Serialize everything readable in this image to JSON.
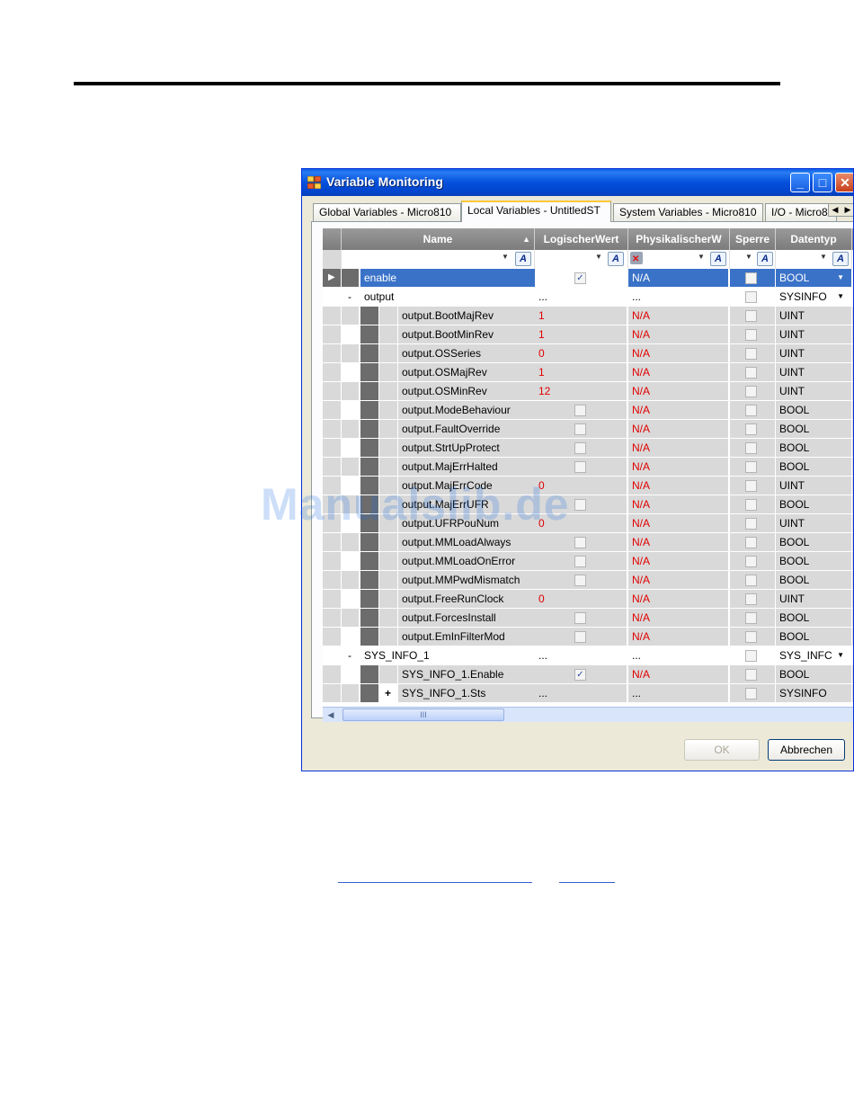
{
  "window": {
    "title": "Variable Monitoring",
    "controls": {
      "minimize": "_",
      "maximize": "□",
      "close": "✕"
    }
  },
  "tabs": [
    {
      "label": "Global Variables - Micro810",
      "active": false
    },
    {
      "label": "Local Variables - UntitledST",
      "active": true
    },
    {
      "label": "System Variables - Micro810",
      "active": false
    },
    {
      "label": "I/O - Micro810",
      "active": false
    }
  ],
  "columns": {
    "name": "Name",
    "logical": "LogischerWert",
    "physical": "PhysikalischerW",
    "lock": "Sperre",
    "type": "Datentyp"
  },
  "rows": [
    {
      "name": "enable",
      "level": 0,
      "logical": "",
      "logical_check": "✓",
      "physical": "N/A",
      "type": "BOOL",
      "selected": true,
      "expander": "",
      "dropdown": true
    },
    {
      "name": "output",
      "level": 0,
      "logical": "...",
      "physical": "...",
      "type": "SYSINFO",
      "expander": "-",
      "dropdown": true
    },
    {
      "name": "output.BootMajRev",
      "level": 1,
      "logical": "1",
      "physical": "N/A",
      "type": "UINT"
    },
    {
      "name": "output.BootMinRev",
      "level": 1,
      "logical": "1",
      "physical": "N/A",
      "type": "UINT"
    },
    {
      "name": "output.OSSeries",
      "level": 1,
      "logical": "0",
      "physical": "N/A",
      "type": "UINT"
    },
    {
      "name": "output.OSMajRev",
      "level": 1,
      "logical": "1",
      "physical": "N/A",
      "type": "UINT"
    },
    {
      "name": "output.OSMinRev",
      "level": 1,
      "logical": "12",
      "physical": "N/A",
      "type": "UINT"
    },
    {
      "name": "output.ModeBehaviour",
      "level": 1,
      "logical": "",
      "logical_check": "",
      "physical": "N/A",
      "type": "BOOL"
    },
    {
      "name": "output.FaultOverride",
      "level": 1,
      "logical": "",
      "logical_check": "",
      "physical": "N/A",
      "type": "BOOL"
    },
    {
      "name": "output.StrtUpProtect",
      "level": 1,
      "logical": "",
      "logical_check": "",
      "physical": "N/A",
      "type": "BOOL"
    },
    {
      "name": "output.MajErrHalted",
      "level": 1,
      "logical": "",
      "logical_check": "",
      "physical": "N/A",
      "type": "BOOL"
    },
    {
      "name": "output.MajErrCode",
      "level": 1,
      "logical": "0",
      "physical": "N/A",
      "type": "UINT"
    },
    {
      "name": "output.MajErrUFR",
      "level": 1,
      "logical": "",
      "logical_check": "",
      "physical": "N/A",
      "type": "BOOL"
    },
    {
      "name": "output.UFRPouNum",
      "level": 1,
      "logical": "0",
      "physical": "N/A",
      "type": "UINT"
    },
    {
      "name": "output.MMLoadAlways",
      "level": 1,
      "logical": "",
      "logical_check": "",
      "physical": "N/A",
      "type": "BOOL"
    },
    {
      "name": "output.MMLoadOnError",
      "level": 1,
      "logical": "",
      "logical_check": "",
      "physical": "N/A",
      "type": "BOOL"
    },
    {
      "name": "output.MMPwdMismatch",
      "level": 1,
      "logical": "",
      "logical_check": "",
      "physical": "N/A",
      "type": "BOOL"
    },
    {
      "name": "output.FreeRunClock",
      "level": 1,
      "logical": "0",
      "physical": "N/A",
      "type": "UINT"
    },
    {
      "name": "output.ForcesInstall",
      "level": 1,
      "logical": "",
      "logical_check": "",
      "physical": "N/A",
      "type": "BOOL"
    },
    {
      "name": "output.EmInFilterMod",
      "level": 1,
      "logical": "",
      "logical_check": "",
      "physical": "N/A",
      "type": "BOOL"
    },
    {
      "name": "SYS_INFO_1",
      "level": 0,
      "logical": "...",
      "physical": "...",
      "type": "SYS_INFC",
      "expander": "-",
      "dropdown": true
    },
    {
      "name": "SYS_INFO_1.Enable",
      "level": 1,
      "logical": "",
      "logical_check": "✓",
      "physical": "N/A",
      "type": "BOOL"
    },
    {
      "name": "SYS_INFO_1.Sts",
      "level": 1,
      "logical": "...",
      "physical": "...",
      "type": "SYSINFO",
      "expander": "+"
    }
  ],
  "scrollbar": {
    "left": "◀",
    "right": "▶",
    "grip": "III"
  },
  "buttons": {
    "ok": "OK",
    "cancel": "Abbrechen"
  },
  "watermark": "Manualslib.de",
  "colors": {
    "value_red": "#e00000",
    "title_blue": "#0450dc",
    "selection": "#3a72c8"
  }
}
